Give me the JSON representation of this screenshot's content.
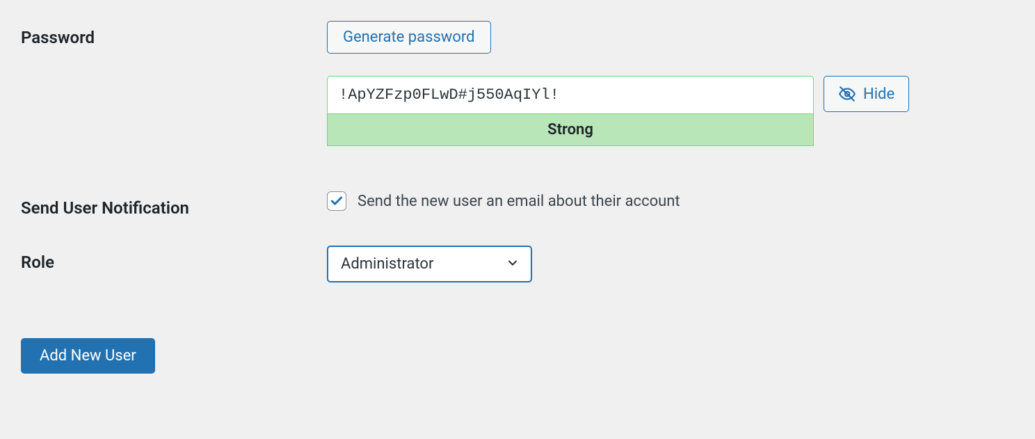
{
  "password": {
    "label": "Password",
    "generate_button": "Generate password",
    "value": "!ApYZFzp0FLwD#j550AqIYl!",
    "strength": "Strong",
    "hide_button": "Hide"
  },
  "notification": {
    "label": "Send User Notification",
    "checkbox_label": "Send the new user an email about their account",
    "checked": true
  },
  "role": {
    "label": "Role",
    "selected": "Administrator"
  },
  "submit": {
    "label": "Add New User"
  }
}
